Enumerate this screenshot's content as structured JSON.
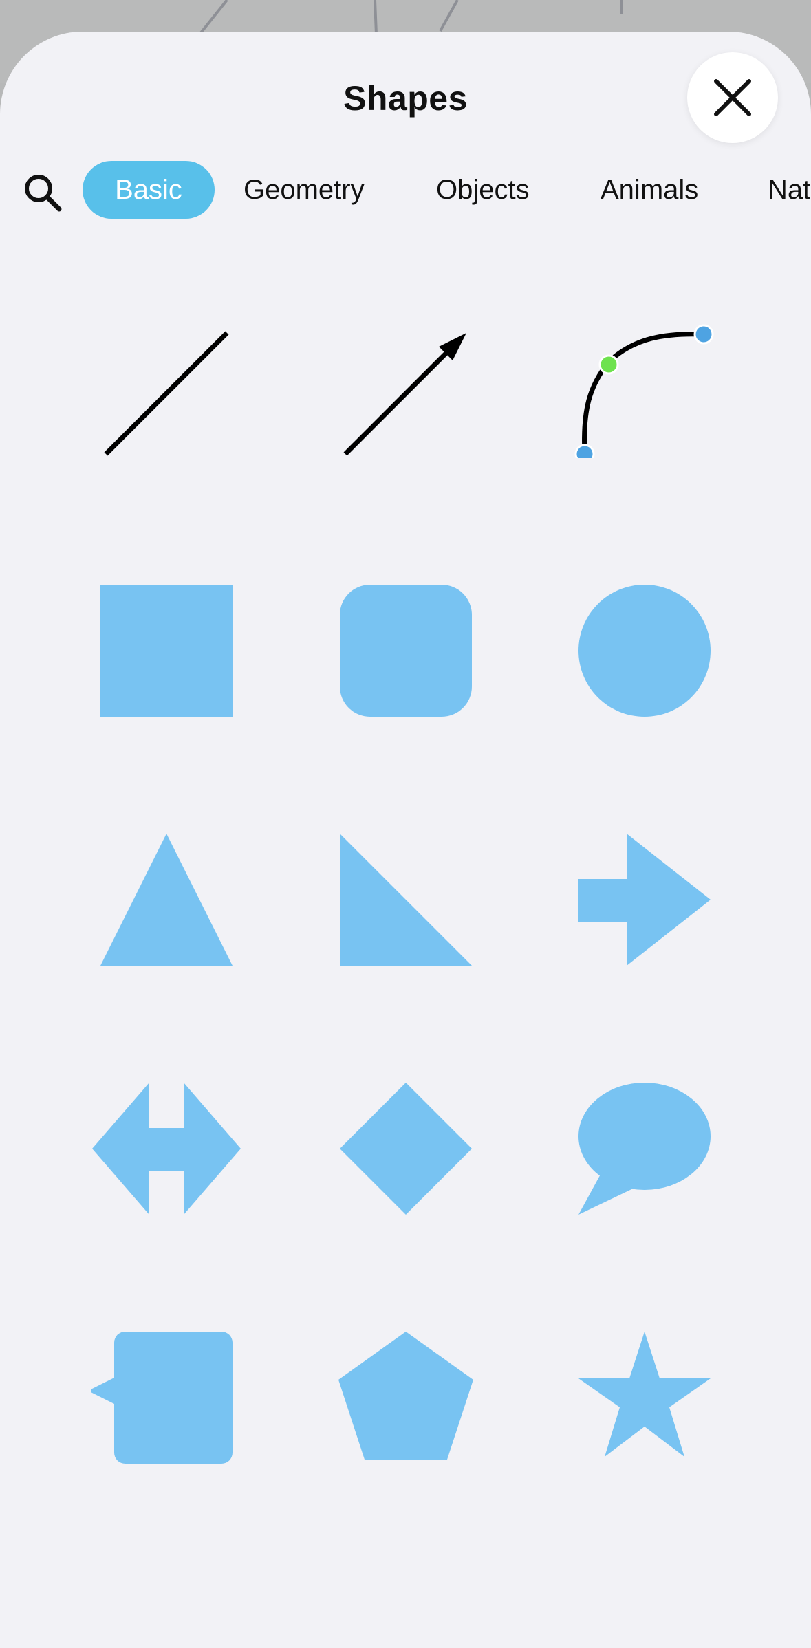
{
  "header": {
    "title": "Shapes"
  },
  "icons": {
    "close": "close-icon",
    "search": "search-icon"
  },
  "tabs": [
    {
      "label": "Basic",
      "active": true
    },
    {
      "label": "Geometry",
      "active": false
    },
    {
      "label": "Objects",
      "active": false
    },
    {
      "label": "Animals",
      "active": false
    },
    {
      "label": "Nature",
      "active": false
    }
  ],
  "shapes": [
    "line",
    "arrow",
    "curve",
    "square",
    "rounded-square",
    "circle",
    "triangle",
    "right-triangle",
    "arrow-shape",
    "double-arrow",
    "diamond",
    "speech-bubble",
    "callout",
    "pentagon",
    "star"
  ],
  "colors": {
    "accent": "#58c0ea",
    "shape_fill": "#78c3f2",
    "sheet_bg": "#f2f2f6",
    "handle_blue": "#4ea3e2",
    "handle_green": "#6ee24e"
  }
}
